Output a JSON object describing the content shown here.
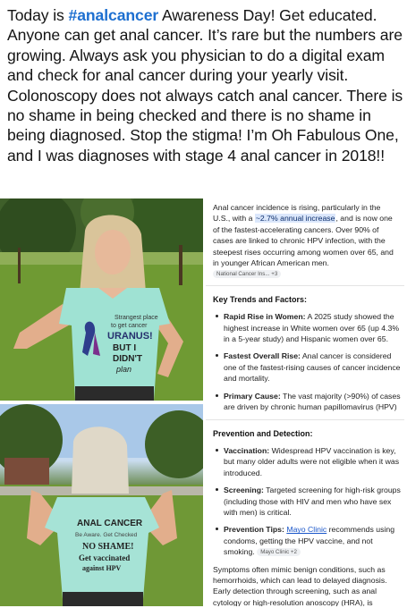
{
  "post": {
    "line_prefix": "Today is ",
    "hashtag": "#analcancer",
    "text": " Awareness Day! Get educated. Anyone can get anal cancer. It’s rare but the numbers are growing. Always ask you physician to do a digital exam and check for anal cancer during your yearly visit. Colonoscopy does not always catch anal cancer. There is no shame in being checked and there is no shame in being diagnosed. Stop the stigma! I’m Oh Fabulous One, and I was diagnoses with stage 4 anal cancer in 2018!!"
  },
  "photos": {
    "top_shirt": {
      "line1": "Strangest place",
      "line2": "to get cancer",
      "line3": "URANUS!",
      "line4": "BUT I",
      "line5": "DIDN'T",
      "line6": "plan"
    },
    "bottom_shirt": {
      "line1": "ANAL CANCER",
      "line2": "Be Aware. Get Checked",
      "line3": "NO SHAME!",
      "line4": "Get vaccinated",
      "line5": "against HPV"
    }
  },
  "ai_panel": {
    "intro_a": "Anal cancer incidence is rising, particularly in the U.S., with a ",
    "intro_highlight": "~2.7% annual increase",
    "intro_b": ", and is now one of the fastest-accelerating cancers. Over 90% of cases are linked to chronic HPV infection, with the steepest rises occurring among women over 65, and in younger African American men.",
    "intro_chip": "National Cancer Ins... +3",
    "trends_heading": "Key Trends and Factors:",
    "trends": [
      {
        "title": "Rapid Rise in Women:",
        "text": " A 2025 study showed the highest increase in White women over 65 (up 4.3% in a 5-year study) and Hispanic women over 65."
      },
      {
        "title": "Fastest Overall Rise:",
        "text": " Anal cancer is considered one of the fastest-rising causes of cancer incidence and mortality."
      },
      {
        "title": "Primary Cause:",
        "text": " The vast majority (>90%) of cases are driven by chronic human papillomavirus (HPV)"
      }
    ],
    "prevention_heading": "Prevention and Detection:",
    "prevention": [
      {
        "title": "Vaccination:",
        "text": " Widespread HPV vaccination is key, but many older adults were not eligible when it was introduced."
      },
      {
        "title": "Screening:",
        "text": " Targeted screening for high-risk groups (including those with HIV and men who have sex with men) is critical."
      }
    ],
    "tips_title": "Prevention Tips:",
    "tips_link": "Mayo Clinic",
    "tips_text": " recommends using condoms, getting the HPV vaccine, and not smoking.",
    "tips_chip": "Mayo Clinic +2",
    "outro": "Symptoms often mimic benign conditions, such as hemorrhoids, which can lead to delayed diagnosis. Early detection through screening, such as anal cytology or high-resolution anoscopy (HRA), is important for effective"
  }
}
